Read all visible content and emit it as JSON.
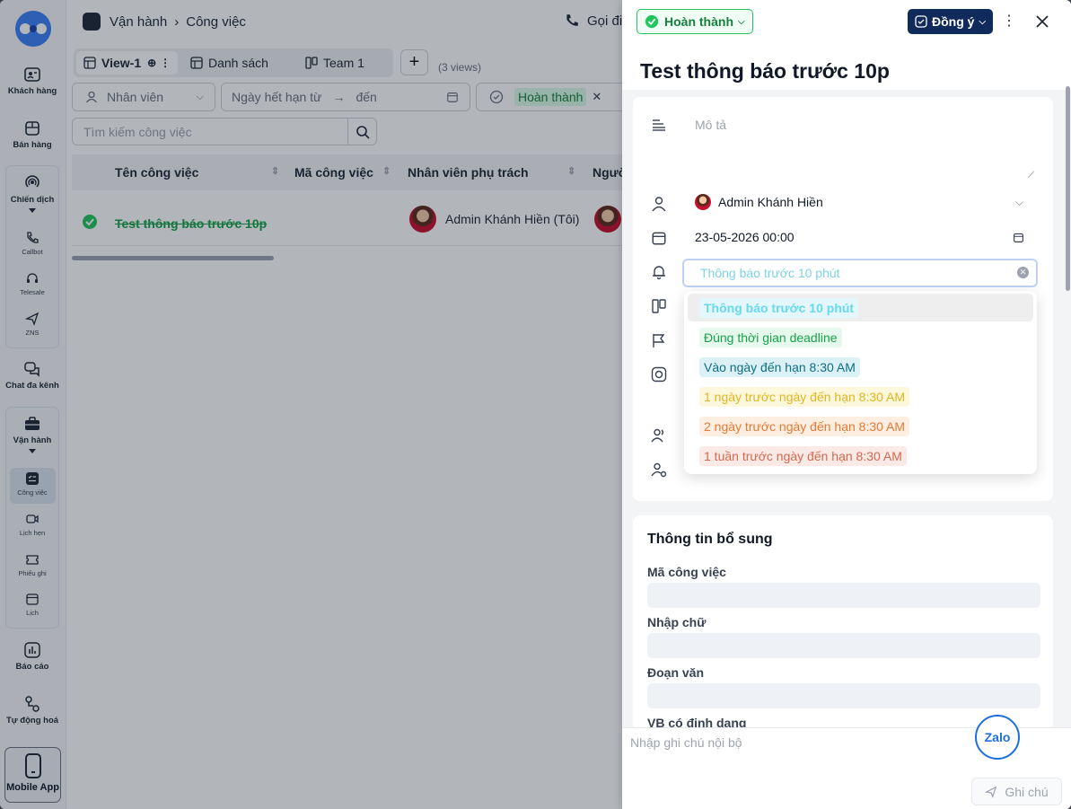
{
  "rail": {
    "items": [
      {
        "label": "Khách hàng"
      },
      {
        "label": "Bán hàng"
      },
      {
        "label": "Chiến dịch"
      },
      {
        "label": "Callbot"
      },
      {
        "label": "Telesale"
      },
      {
        "label": "ZNS"
      },
      {
        "label": "Chat đa kênh"
      },
      {
        "label": "Vận hành"
      },
      {
        "label": "Công việc"
      },
      {
        "label": "Lịch hẹn"
      },
      {
        "label": "Phiếu ghi"
      },
      {
        "label": "Lịch"
      },
      {
        "label": "Báo cáo"
      },
      {
        "label": "Tự động hoá"
      },
      {
        "label": "Mobile App"
      }
    ]
  },
  "main": {
    "breadcrumb": {
      "parent": "Vận hành",
      "current": "Công việc"
    },
    "call_label": "Gọi điệ",
    "tabs": [
      {
        "label": "View-1"
      },
      {
        "label": "Danh sách"
      },
      {
        "label": "Team 1"
      }
    ],
    "views_count": "(3 views)",
    "filters": {
      "staff_placeholder": "Nhân viên",
      "date_from_placeholder": "Ngày hết hạn từ",
      "date_to_placeholder": "đến",
      "status_value": "Hoàn thành"
    },
    "search_placeholder": "Tìm kiếm công việc",
    "table": {
      "columns": [
        "Tên công việc",
        "Mã công việc",
        "Nhân viên phụ trách",
        "Người"
      ],
      "rows": [
        {
          "name": "Test thông báo trước 10p",
          "code": "",
          "assignee": "Admin Khánh Hiền (Tôi)"
        }
      ]
    }
  },
  "drawer": {
    "status": "Hoàn thành",
    "agree_label": "Đồng ý",
    "title": "Test thông báo trước 10p",
    "description_placeholder": "Mô tả",
    "assignee": "Admin Khánh Hiền",
    "due_date": "23-05-2026 00:00",
    "reminder_value": "Thông báo trước 10 phút",
    "reminder_options": [
      {
        "label": "Thông báo trước 10 phút",
        "color": "#22d3ee",
        "bg": "#e6f9fd"
      },
      {
        "label": "Đúng thời gian deadline",
        "color": "#16a34a",
        "bg": "#e7f8ed"
      },
      {
        "label": "Vào ngày đến hạn 8:30 AM",
        "color": "#0e7490",
        "bg": "#dff3f7"
      },
      {
        "label": "1 ngày trước ngày đến hạn 8:30 AM",
        "color": "#eab308",
        "bg": "#fdf7dc"
      },
      {
        "label": "2 ngày trước ngày đến hạn 8:30 AM",
        "color": "#ea7a2c",
        "bg": "#fdeee2"
      },
      {
        "label": "1 tuần trước ngày đến hạn 8:30 AM",
        "color": "#dc6b50",
        "bg": "#fbe9e5"
      }
    ],
    "extra": {
      "title": "Thông tin bổ sung",
      "fields": [
        {
          "label": "Mã công việc"
        },
        {
          "label": "Nhập chữ"
        },
        {
          "label": "Đoạn văn"
        },
        {
          "label": "VB có định dạng"
        }
      ]
    },
    "note_placeholder": "Nhập ghi chú nội bộ",
    "zalo_label": "Zalo",
    "send_label": "Ghi chú"
  }
}
